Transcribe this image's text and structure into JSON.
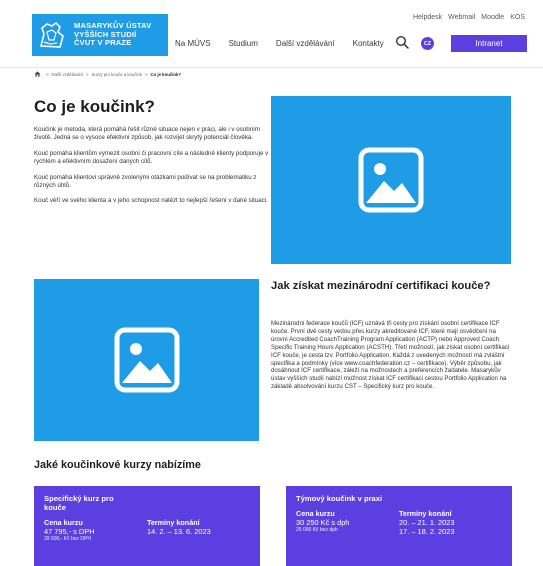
{
  "header": {
    "logo_lines": [
      "MASARYKŮV ÚSTAV",
      "VYŠŠÍCH STUDIÍ",
      "ČVUT V PRAZE"
    ],
    "util_links": [
      "Helpdesk",
      "Webmail",
      "Moodle",
      "KOS"
    ],
    "nav": [
      "Na MÚVS",
      "Studium",
      "Další vzdělávání",
      "Kontakty"
    ],
    "lang": "CZ",
    "intranet": "Intranet"
  },
  "breadcrumb": {
    "items": [
      "Další vzdělávání",
      "Kurzy pro kouče a koučink",
      "Co je koučink?"
    ],
    "separator": ">"
  },
  "section1": {
    "title": "Co je koučink?",
    "paragraphs": [
      "Koučink je metoda, která pomáhá řešit různé situace nejen v práci, ale i v osobním životě. Jedná se o vysoce efektivní způsob, jak rozvíjet skrytý potenciál člověka.",
      "Kouč pomáhá klientům vymezit osobní či pracovní cíle a následně klienty podporuje v rychlém a efektivním dosažení daných cílů.",
      "Kouč pomáhá klientovi správně zvolenými otázkami podívat se na problematiku z různých úhlů.",
      "Kouč věří ve svého klienta a v jeho schopnost nalézt to nejlepší řešení v dané situaci."
    ]
  },
  "section2": {
    "title": "Jak získat mezinárodní certifikaci kouče?",
    "text": "Mezinárodní federace koučů (ICF) uznává tři cesty pro získání osobní certifikace ICF kouče. První dvě cesty vedou přes kurzy akreditované ICF, které mají osvědčení na úrovni Accredited CoachTraining Program Application (ACTP) nebo Approved Coach Specific Training Hours Application (ACSTH). Třetí možností, jak získat osobní certifikaci ICF kouče, je cesta tzv. Portfolio Application. Každá z uvedených možností má zvláštní specifika a podmínky (více www.coachfederation.cz – certifikace). Výběr způsobu, jak dosáhnout ICF certifikace, záleží na možnostech a preferencích žadatele. Masarykův ústav vyšších studií nabízí možnost získat ICF certifikaci cestou Portfolio Application na základě absolvování kurzu CST – Specifický kurz pro kouče."
  },
  "section3": {
    "title": "Jaké koučinkové kurzy nabízíme"
  },
  "cards": [
    {
      "title": "Specifický kurz pro kouče",
      "price_label": "Cena kurzu",
      "price": "47 795,- s DPH",
      "price_sub": "39 500,- Kč bez DPH",
      "dates_label": "Termíny konání",
      "dates": [
        "14. 2. – 13. 6. 2023"
      ]
    },
    {
      "title": "Týmový koučink v praxi",
      "price_label": "Cena kurzu",
      "price": "30 250 Kč s dph",
      "price_sub": "25 000 Kč bez dph",
      "dates_label": "Termíny konání",
      "dates": [
        "20. – 21. 1. 2023",
        "17. – 18. 2. 2023"
      ]
    }
  ],
  "colors": {
    "brand_blue": "#1f9ce6",
    "accent_purple": "#5c3fe0"
  }
}
